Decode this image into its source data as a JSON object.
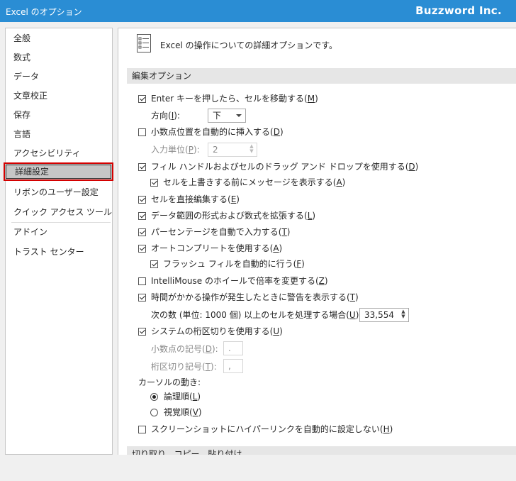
{
  "window": {
    "title": "Excel のオプション",
    "brand": "Buzzword Inc."
  },
  "sidebar": {
    "items": [
      {
        "label": "全般"
      },
      {
        "label": "数式"
      },
      {
        "label": "データ"
      },
      {
        "label": "文章校正"
      },
      {
        "label": "保存"
      },
      {
        "label": "言語"
      },
      {
        "label": "アクセシビリティ"
      },
      {
        "label": "詳細設定",
        "selected": true
      },
      {
        "label": "リボンのユーザー設定"
      },
      {
        "label": "クイック アクセス ツール バー"
      },
      {
        "label": "アドイン"
      },
      {
        "label": "トラスト センター"
      }
    ]
  },
  "main": {
    "header": "Excel の操作についての詳細オプションです。",
    "sections": {
      "edit": "編集オプション",
      "cutcopy": "切り取り、コピー、貼り付け"
    },
    "options": {
      "enter_move": {
        "text": "Enter キーを押したら、セルを移動する(",
        "key": "M",
        "end": ")",
        "checked": true
      },
      "direction": {
        "label": "方向(",
        "key": "I",
        "end": "):",
        "value": "下"
      },
      "decimal_auto": {
        "text": "小数点位置を自動的に挿入する(",
        "key": "D",
        "end": ")",
        "checked": false
      },
      "places": {
        "label": "入力単位(",
        "key": "P",
        "end": "):",
        "value": "2"
      },
      "fill_handle": {
        "text": "フィル ハンドルおよびセルのドラッグ アンド ドロップを使用する(",
        "key": "D",
        "end": ")",
        "checked": true
      },
      "overwrite_alert": {
        "text": "セルを上書きする前にメッセージを表示する(",
        "key": "A",
        "end": ")",
        "checked": true
      },
      "edit_in_cell": {
        "text": "セルを直接編集する(",
        "key": "E",
        "end": ")",
        "checked": true
      },
      "extend_formats": {
        "text": "データ範囲の形式および数式を拡張する(",
        "key": "L",
        "end": ")",
        "checked": true
      },
      "auto_percent": {
        "text": "パーセンテージを自動で入力する(",
        "key": "T",
        "end": ")",
        "checked": true
      },
      "autocomplete": {
        "text": "オートコンプリートを使用する(",
        "key": "A",
        "end": ")",
        "checked": true
      },
      "flash_fill": {
        "text": "フラッシュ フィルを自動的に行う(",
        "key": "F",
        "end": ")",
        "checked": true
      },
      "intellimouse": {
        "text": "IntelliMouse のホイールで倍率を変更する(",
        "key": "Z",
        "end": ")",
        "checked": false
      },
      "alert_slow": {
        "text": "時間がかかる操作が発生したときに警告を表示する(",
        "key": "T",
        "end": ")",
        "checked": true
      },
      "cells_threshold": {
        "label": "次の数 (単位: 1000 個) 以上のセルを処理する場合(",
        "key": "U",
        "end": "):",
        "value": "33,554"
      },
      "system_sep": {
        "text": "システムの桁区切りを使用する(",
        "key": "U",
        "end": ")",
        "checked": true
      },
      "decimal_sep": {
        "label": "小数点の記号(",
        "key": "D",
        "end": "):",
        "value": "."
      },
      "thousands_sep": {
        "label": "桁区切り記号(",
        "key": "T",
        "end": "):",
        "value": ","
      },
      "cursor_move": {
        "label": "カーソルの動き:"
      },
      "logical": {
        "text": "論理順(",
        "key": "L",
        "end": ")",
        "checked": true
      },
      "visual": {
        "text": "視覚順(",
        "key": "V",
        "end": ")",
        "checked": false
      },
      "screenshot_link": {
        "text": "スクリーンショットにハイパーリンクを自動的に設定しない(",
        "key": "H",
        "end": ")",
        "checked": false
      }
    }
  }
}
